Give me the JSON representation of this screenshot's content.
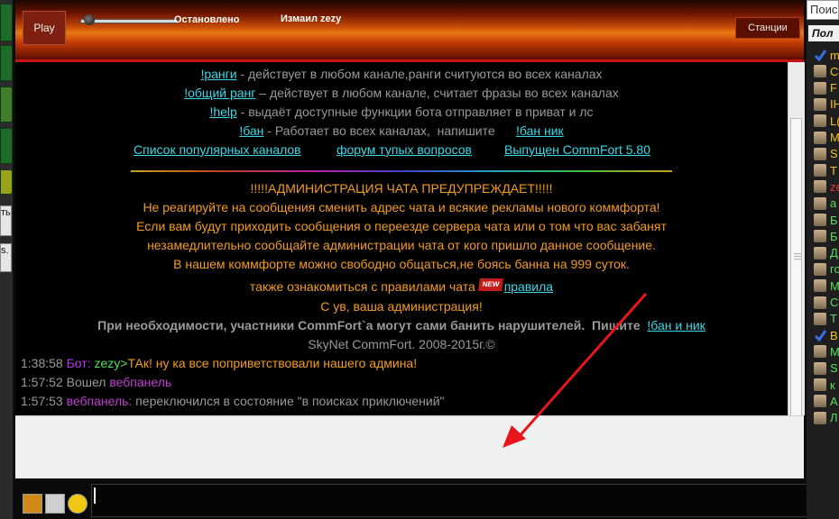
{
  "player": {
    "play_label": "Play",
    "status": "Остановлено",
    "now_playing": "Измаил zezy",
    "stations_label": "Станции"
  },
  "left_strip": {
    "label_1": "ть",
    "label_2": "s."
  },
  "chat": {
    "info_lines": [
      {
        "cmd": "!ранги",
        "text": " - действует в любом канале,ранги считуются  во всех  каналах"
      },
      {
        "cmd": "!общий ранг",
        "text": " – действует в любом канале, считает фразы во всех каналах"
      },
      {
        "cmd": "!help",
        "text": " - выдаёт доступные функции бота  отправляет в приват и лс"
      },
      {
        "cmd": "!бан",
        "text": " - Работает во всех каналах,  напишите      ",
        "cmd2": "!бан ник"
      }
    ],
    "links": [
      "Список популярных каналов",
      "форум тупых  вопросов",
      "Выпущен CommFort 5.80"
    ],
    "warning_title": "!!!!!АДМИНИСТРАЦИЯ ЧАТА ПРЕДУПРЕЖДАЕТ!!!!!",
    "warning_lines": [
      "Не реагируйте на сообщения сменить адрес чата и всякие рекламы нового коммфорта!",
      "Если вам будут приходить сообщения о переезде сервера чата или о том что вас забанят",
      "незамедлительно сообщайте администрации чата от кого пришло данное сообщение.",
      "В нашем коммфорте можно свободно общаться,не боясь банна на 999 суток."
    ],
    "rules_text": "также ознакомиться с правилами чата ",
    "new_badge": "NEW",
    "rules_link": "правила",
    "regards": "С ув, ваша администрация!",
    "ban_note": "При необходимости, участники CommFort`a могут сами банить нарушителей.  Пишите  ",
    "ban_link": "!бан и ник",
    "footer": "SkyNet CommFort. 2008-2015г.©",
    "messages": [
      {
        "time": "1:38:58",
        "sender": "Бот:",
        "target": "zezy>",
        "text": "ТАк! ну ка все поприветствовали нашего админа!"
      },
      {
        "time": "1:57:52",
        "prefix": "Вошел ",
        "nick": "вебпанель"
      },
      {
        "time": "1:57:53",
        "nick": "вебпанель:",
        "text": " переключился в состояние \"в поисках приключений\""
      }
    ]
  },
  "users_panel": {
    "search_text": "Поиск",
    "header": "Пол",
    "users": [
      {
        "initial": "m",
        "color": "#f2c11c",
        "icon": "check-icon"
      },
      {
        "initial": "C",
        "color": "#f2c11c",
        "icon": "user-icon"
      },
      {
        "initial": "F",
        "color": "#f2c11c",
        "icon": "user-icon"
      },
      {
        "initial": "IH",
        "color": "#f2c11c",
        "icon": "user-icon"
      },
      {
        "initial": "L(",
        "color": "#f2c11c",
        "icon": "user-icon"
      },
      {
        "initial": "M",
        "color": "#f2c11c",
        "icon": "user-icon"
      },
      {
        "initial": "S",
        "color": "#f2c11c",
        "icon": "user-icon"
      },
      {
        "initial": "T",
        "color": "#f2c11c",
        "icon": "user-icon"
      },
      {
        "initial": "ze",
        "color": "#e23a3a",
        "icon": "user-icon"
      },
      {
        "initial": "a",
        "color": "#55e05a",
        "icon": "user-icon"
      },
      {
        "initial": "Б",
        "color": "#55e05a",
        "icon": "user-icon"
      },
      {
        "initial": "Б",
        "color": "#55e05a",
        "icon": "user-icon"
      },
      {
        "initial": "Д",
        "color": "#55e05a",
        "icon": "user-icon"
      },
      {
        "initial": "го",
        "color": "#55e05a",
        "icon": "user-icon"
      },
      {
        "initial": "М",
        "color": "#55e05a",
        "icon": "user-icon"
      },
      {
        "initial": "С",
        "color": "#55e05a",
        "icon": "user-icon"
      },
      {
        "initial": "Т",
        "color": "#55e05a",
        "icon": "user-icon"
      },
      {
        "initial": "В",
        "color": "#f2c11c",
        "icon": "check-icon"
      },
      {
        "initial": "М",
        "color": "#55e05a",
        "icon": "user-icon"
      },
      {
        "initial": "S",
        "color": "#55e05a",
        "icon": "user-icon"
      },
      {
        "initial": "к",
        "color": "#55e05a",
        "icon": "user-icon"
      },
      {
        "initial": "А",
        "color": "#55e05a",
        "icon": "user-icon"
      },
      {
        "initial": "Л",
        "color": "#55e05a",
        "icon": "user-icon"
      }
    ]
  },
  "colors": {
    "link": "#3ad8e6",
    "warning": "#f39c1c",
    "bot": "#b83ae6",
    "annotation_arrow": "#e8161c"
  }
}
